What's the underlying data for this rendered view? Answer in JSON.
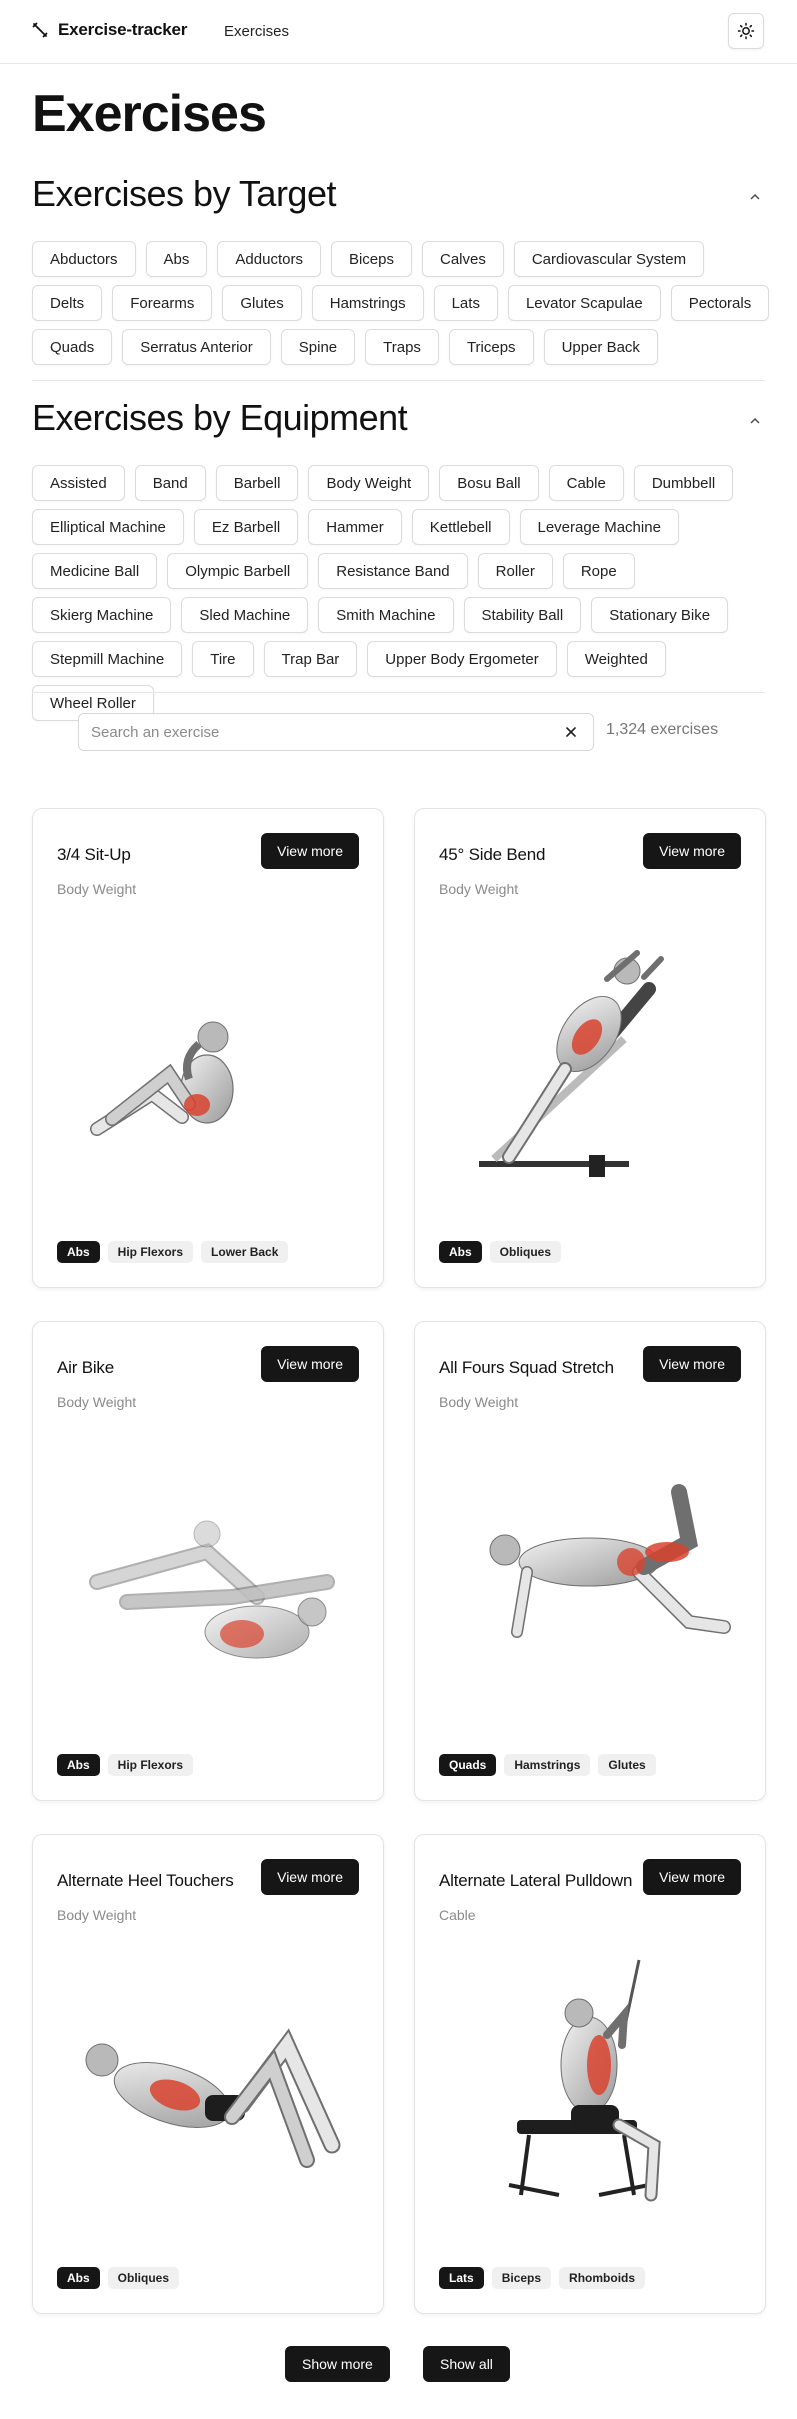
{
  "header": {
    "brand": "Exercise-tracker",
    "brand_icon": "dumbbell-icon",
    "nav_link": "Exercises",
    "theme_icon": "sun-icon"
  },
  "page_title": "Exercises",
  "target_section": {
    "title": "Exercises by Target",
    "collapse_icon": "chevron-up-icon",
    "items": [
      "Abductors",
      "Abs",
      "Adductors",
      "Biceps",
      "Calves",
      "Cardiovascular System",
      "Delts",
      "Forearms",
      "Glutes",
      "Hamstrings",
      "Lats",
      "Levator Scapulae",
      "Pectorals",
      "Quads",
      "Serratus Anterior",
      "Spine",
      "Traps",
      "Triceps",
      "Upper Back"
    ]
  },
  "equipment_section": {
    "title": "Exercises by Equipment",
    "collapse_icon": "chevron-up-icon",
    "items": [
      "Assisted",
      "Band",
      "Barbell",
      "Body Weight",
      "Bosu Ball",
      "Cable",
      "Dumbbell",
      "Elliptical Machine",
      "Ez Barbell",
      "Hammer",
      "Kettlebell",
      "Leverage Machine",
      "Medicine Ball",
      "Olympic Barbell",
      "Resistance Band",
      "Roller",
      "Rope",
      "Skierg Machine",
      "Sled Machine",
      "Smith Machine",
      "Stability Ball",
      "Stationary Bike",
      "Stepmill Machine",
      "Tire",
      "Trap Bar",
      "Upper Body Ergometer",
      "Weighted",
      "Wheel Roller"
    ]
  },
  "search": {
    "placeholder": "Search an exercise",
    "value": "",
    "clear_icon": "close-icon",
    "count": "1,324 exercises"
  },
  "view_more_label": "View more",
  "highlight_color": "#d9432f",
  "exercises": [
    {
      "name": "3/4 Sit-Up",
      "equipment": "Body Weight",
      "muscles": [
        "Abs",
        "Hip Flexors",
        "Lower Back"
      ]
    },
    {
      "name": "45° Side Bend",
      "equipment": "Body Weight",
      "muscles": [
        "Abs",
        "Obliques"
      ]
    },
    {
      "name": "Air Bike",
      "equipment": "Body Weight",
      "muscles": [
        "Abs",
        "Hip Flexors"
      ]
    },
    {
      "name": "All Fours Squad Stretch",
      "equipment": "Body Weight",
      "muscles": [
        "Quads",
        "Hamstrings",
        "Glutes"
      ]
    },
    {
      "name": "Alternate Heel Touchers",
      "equipment": "Body Weight",
      "muscles": [
        "Abs",
        "Obliques"
      ]
    },
    {
      "name": "Alternate Lateral Pulldown",
      "equipment": "Cable",
      "muscles": [
        "Lats",
        "Biceps",
        "Rhomboids"
      ]
    }
  ],
  "buttons": {
    "show_more": "Show more",
    "show_all": "Show all"
  }
}
